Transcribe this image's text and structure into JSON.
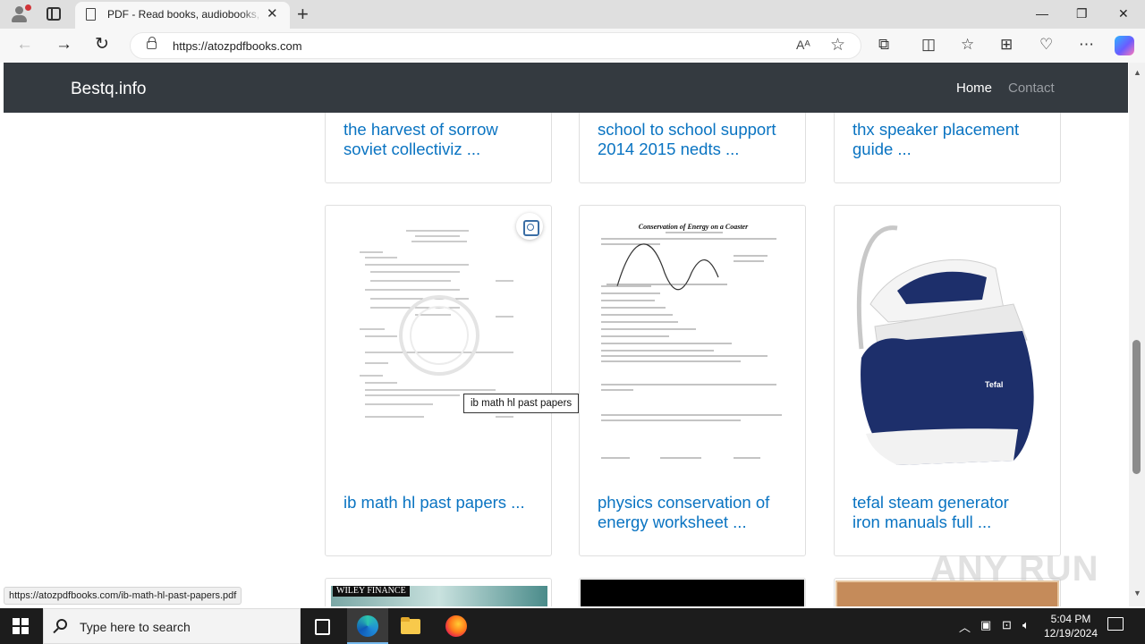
{
  "browser": {
    "tab_title": "PDF - Read books, audiobooks, and more",
    "tab_close": "✕",
    "new_tab": "+",
    "url": "https://atozpdfbooks.com",
    "window_controls": {
      "minimize": "—",
      "maximize": "❐",
      "close": "✕"
    },
    "nav": {
      "back": "←",
      "forward": "→",
      "reload": "↻"
    },
    "read_aloud": "Aᴬ",
    "favorite": "☆",
    "toolbar_icons": [
      "extensions-icon",
      "split-screen-icon",
      "favorites-icon",
      "collections-icon",
      "browser-essentials-icon",
      "more-icon"
    ],
    "toolbar_glyphs": {
      "extensions": "⧉",
      "split": "◫",
      "favorites": "☆",
      "collections": "⊞",
      "essentials": "♡",
      "more": "⋯"
    }
  },
  "site": {
    "brand": "Bestq.info",
    "nav": [
      {
        "label": "Home",
        "color": "#ffffff"
      },
      {
        "label": "Contact",
        "color": "#9a9ea3"
      }
    ]
  },
  "cards_top": [
    {
      "title_line1": "the harvest of sorrow",
      "title_line2": "soviet collectiviz ..."
    },
    {
      "title_line1": "school to school support",
      "title_line2": "2014 2015 nedts ..."
    },
    {
      "title_line1": "thx speaker placement",
      "title_line2": "guide ..."
    }
  ],
  "cards_middle": [
    {
      "title_line1": "ib math hl past papers ...",
      "title_line2": "",
      "thumb": "exam-paper-thumbnail"
    },
    {
      "title_line1": "physics conservation of",
      "title_line2": "energy worksheet ...",
      "thumb": "worksheet-thumbnail",
      "worksheet_heading": "Conservation of Energy on a Coaster"
    },
    {
      "title_line1": "tefal steam generator",
      "title_line2": "iron manuals full ...",
      "thumb": "steam-iron-thumbnail",
      "iron_brand": "Tefal"
    }
  ],
  "cards_bottom_thumbs": [
    {
      "label": "WILEY FINANCE"
    },
    {
      "label": ""
    },
    {
      "label": ""
    }
  ],
  "tooltip": "ib math hl past papers",
  "status_url": "https://atozpdfbooks.com/ib-math-hl-past-papers.pdf",
  "watermark": "ANY RUN",
  "taskbar": {
    "search_placeholder": "Type here to search",
    "time": "5:04 PM",
    "date": "12/19/2024"
  },
  "colors": {
    "navbar": "#343a40",
    "link": "#0a74c2",
    "iron_blue": "#1d2f6b"
  }
}
